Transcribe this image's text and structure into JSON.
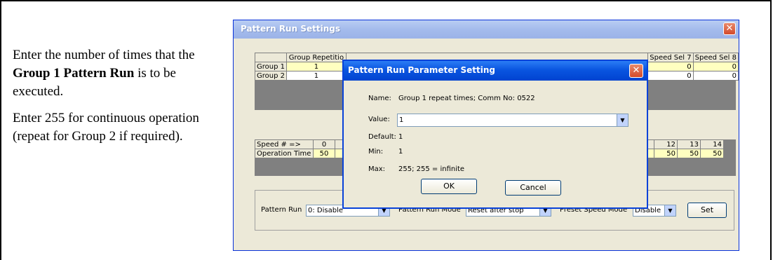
{
  "instruction": {
    "p1_before": "Enter the number of times that the ",
    "p1_bold": "Group 1 Pattern Run",
    "p1_after": " is to be executed.",
    "p2": "Enter 255 for continuous operation (repeat for Group 2 if required)."
  },
  "outer_window": {
    "title": "Pattern Run Settings",
    "close_glyph": "✕",
    "group_table": {
      "headers": [
        "",
        "Group Repetitio",
        "Speed Sel 7",
        "Speed Sel 8"
      ],
      "rows": [
        {
          "label": "Group 1",
          "repeat": "1",
          "sel7": "0",
          "sel8": "0"
        },
        {
          "label": "Group 2",
          "repeat": "1",
          "sel7": "0",
          "sel8": "0"
        }
      ]
    },
    "speed_table": {
      "row1_label": "Speed # =>",
      "row1_left": "0",
      "row2_label": "Operation Time",
      "row2_left": "50",
      "right_headers": [
        "12",
        "13",
        "14"
      ],
      "right_values": [
        "50",
        "50",
        "50"
      ]
    },
    "controls": {
      "pattern_run_label": "Pattern Run",
      "pattern_run_value": "0: Disable",
      "pattern_run_mode_label": "Pattern Run Mode",
      "pattern_run_mode_value": "Reset after stop",
      "preset_speed_mode_label": "Preset Speed Mode",
      "preset_speed_mode_value": "Disable",
      "set_label": "Set"
    }
  },
  "dialog": {
    "title": "Pattern Run Parameter Setting",
    "close_glyph": "✕",
    "name_label": "Name:",
    "name_value": "Group 1 repeat times; Comm No: 0522",
    "value_label": "Value:",
    "value_value": "1",
    "default_label": "Default:",
    "default_value": "1",
    "min_label": "Min:",
    "min_value": "1",
    "max_label": "Max:",
    "max_value": "255;  255 = infinite",
    "ok_label": "OK",
    "cancel_label": "Cancel"
  },
  "icons": {
    "dropdown_arrow": "▼"
  }
}
